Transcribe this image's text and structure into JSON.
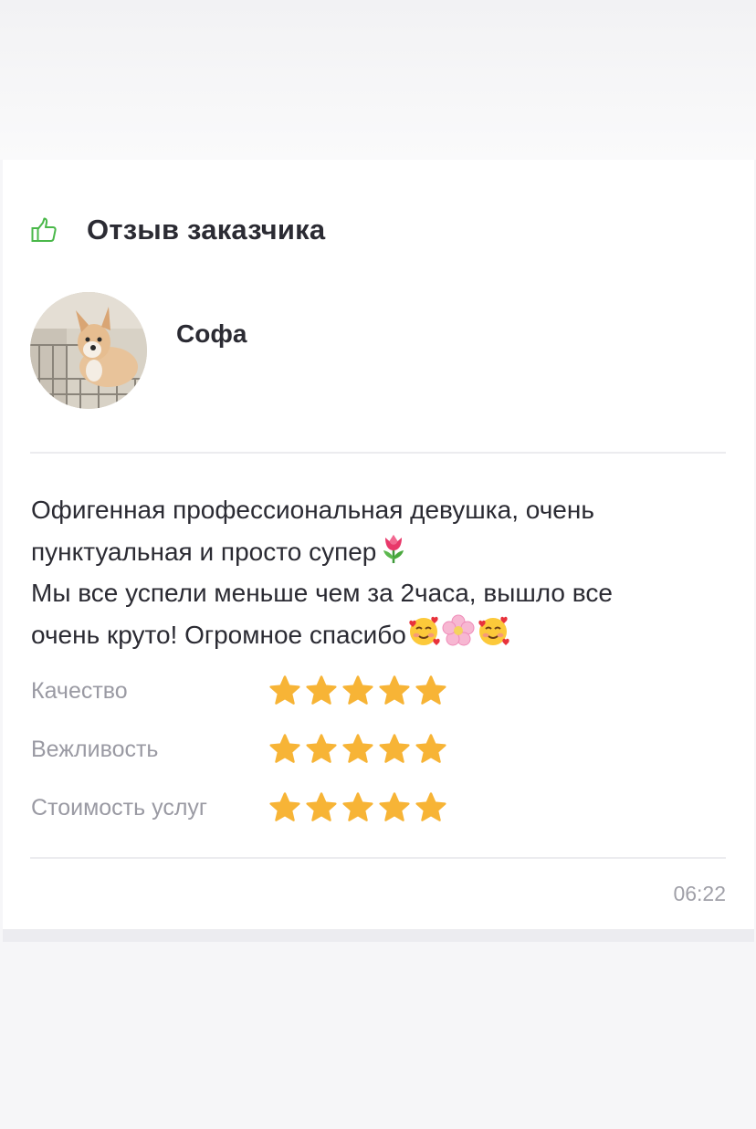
{
  "header": {
    "title": "Отзыв заказчика",
    "icon": "thumbs-up-icon",
    "icon_color": "#4ab84a"
  },
  "user": {
    "name": "Софа",
    "avatar": "dog-photo"
  },
  "review": {
    "line1": "Офигенная профессиональная девушка, очень",
    "line2": "пунктуальная и просто супер",
    "line3": "Мы все успели меньше чем за 2часа, вышло все",
    "line4": "очень круто! Огромное спасибо"
  },
  "ratings": [
    {
      "label": "Качество",
      "stars": 5
    },
    {
      "label": "Вежливость",
      "stars": 5
    },
    {
      "label": "Стоимость услуг",
      "stars": 5
    }
  ],
  "star_color": "#f7b436",
  "time": "06:22"
}
